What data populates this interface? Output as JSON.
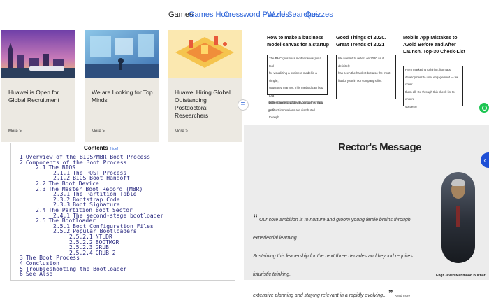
{
  "nav": {
    "items": [
      {
        "label": "Games",
        "active": true
      },
      {
        "label": "Games Home",
        "active": false
      },
      {
        "label": "Crossword Puzzles",
        "active": false
      },
      {
        "label": "Word Searches",
        "active": false
      },
      {
        "label": "Quizzes",
        "active": false
      }
    ]
  },
  "cards": [
    {
      "title": "Huawei is Open for Global Recruitment",
      "more": "More >"
    },
    {
      "title": "We are Looking for Top Minds",
      "more": "More >"
    },
    {
      "title": "Huawei Hiring Global Outstanding Postdoctoral Researchers",
      "more": "More >"
    }
  ],
  "articles": [
    {
      "title": "How to make a business model canvas for a startup",
      "excerpt_lines": [
        "The BMC (business model canvas) is a tool",
        "for visualizing a business model in a simple,",
        "structured manner. This method can lead to a",
        "better understanding of your clients, how",
        "product innovations are distributed through"
      ],
      "after_lines": [
        "sales channels, and who brings the most",
        "profit."
      ]
    },
    {
      "title": "Good Things of 2020. Great Trends of 2021",
      "excerpt_lines": [
        "We wanted to reflect on 2020 as it definitely",
        "has been the hardest but also the most",
        "fruitful year in our company's life."
      ],
      "after_lines": []
    },
    {
      "title": "Mobile App Mistakes to Avoid Before and After Launch. Top-30 Check-List",
      "excerpt_lines": [
        "From marketing to hiring: from app",
        "development to user engagement — we cover",
        "them all. Go through this check-list to ensure",
        "success!"
      ],
      "after_lines": []
    }
  ],
  "rector": {
    "heading": "Rector's Message",
    "quote_open": "“",
    "quote_line1": "Our core ambition is to nurture and groom young fertile brains through experiential learning.",
    "quote_line2": "Sustaining this leadership for the next three decades and beyond requires futuristic thinking,",
    "quote_line3": "extensive planning and staying relevant in a rapidly evolving...",
    "quote_close": "”",
    "read_more": "Read more",
    "caption": "Engr Javed Mahmood Bukhari"
  },
  "contents": {
    "heading": "Contents",
    "hide_link": "[hide]",
    "items": [
      {
        "num": "1",
        "text": "Overview of the BIOS/MBR Boot Process"
      },
      {
        "num": "2",
        "text": "Components of the Boot Process"
      },
      {
        "num": "2.1",
        "text": "The BIOS"
      },
      {
        "num": "2.1.1",
        "text": "The POST Process"
      },
      {
        "num": "2.1.2",
        "text": "BIOS Boot Handoff"
      },
      {
        "num": "2.2",
        "text": "The Boot Device"
      },
      {
        "num": "2.3",
        "text": "The Master Boot Record (MBR)"
      },
      {
        "num": "2.3.1",
        "text": "The Partition Table"
      },
      {
        "num": "2.3.2",
        "text": "Bootstrap Code"
      },
      {
        "num": "2.3.3",
        "text": "Boot Signature"
      },
      {
        "num": "2.4",
        "text": "The Partition Boot Sector"
      },
      {
        "num": "2.4.1",
        "text": "The second-stage bootloader"
      },
      {
        "num": "2.5",
        "text": "The Bootloader"
      },
      {
        "num": "2.5.1",
        "text": "Boot Configuration Files"
      },
      {
        "num": "2.5.2",
        "text": "Popular Bootloaders"
      },
      {
        "num": "2.5.2.1",
        "text": "NTLDR"
      },
      {
        "num": "2.5.2.2",
        "text": "BOOTMGR"
      },
      {
        "num": "2.5.2.3",
        "text": "GRUB"
      },
      {
        "num": "2.5.2.4",
        "text": "GRUB 2"
      },
      {
        "num": "3",
        "text": "The Boot Process"
      },
      {
        "num": "4",
        "text": "Conclusion"
      },
      {
        "num": "5",
        "text": "Troubleshooting the Bootloader"
      },
      {
        "num": "6",
        "text": "See Also"
      }
    ]
  }
}
